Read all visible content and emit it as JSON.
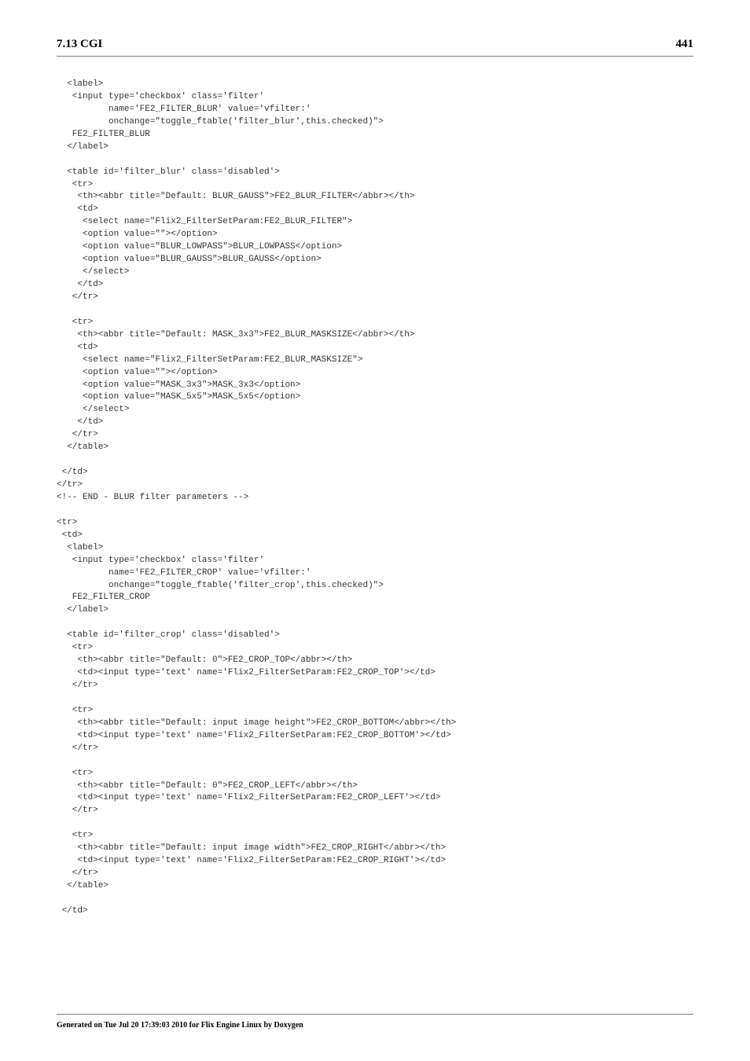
{
  "header": {
    "left": "7.13 CGI",
    "right": "441"
  },
  "code": "  <label>\n   <input type='checkbox' class='filter'\n          name='FE2_FILTER_BLUR' value='vfilter:'\n          onchange=\"toggle_ftable('filter_blur',this.checked)\">\n   FE2_FILTER_BLUR\n  </label>\n\n  <table id='filter_blur' class='disabled'>\n   <tr>\n    <th><abbr title=\"Default: BLUR_GAUSS\">FE2_BLUR_FILTER</abbr></th>\n    <td>\n     <select name=\"Flix2_FilterSetParam:FE2_BLUR_FILTER\">\n     <option value=\"\"></option>\n     <option value=\"BLUR_LOWPASS\">BLUR_LOWPASS</option>\n     <option value=\"BLUR_GAUSS\">BLUR_GAUSS</option>\n     </select>\n    </td>\n   </tr>\n\n   <tr>\n    <th><abbr title=\"Default: MASK_3x3\">FE2_BLUR_MASKSIZE</abbr></th>\n    <td>\n     <select name=\"Flix2_FilterSetParam:FE2_BLUR_MASKSIZE\">\n     <option value=\"\"></option>\n     <option value=\"MASK_3x3\">MASK_3x3</option>\n     <option value=\"MASK_5x5\">MASK_5x5</option>\n     </select>\n    </td>\n   </tr>\n  </table>\n\n </td>\n</tr>\n<!-- END - BLUR filter parameters -->\n\n<tr>\n <td>\n  <label>\n   <input type='checkbox' class='filter'\n          name='FE2_FILTER_CROP' value='vfilter:'\n          onchange=\"toggle_ftable('filter_crop',this.checked)\">\n   FE2_FILTER_CROP\n  </label>\n\n  <table id='filter_crop' class='disabled'>\n   <tr>\n    <th><abbr title=\"Default: 0\">FE2_CROP_TOP</abbr></th>\n    <td><input type='text' name='Flix2_FilterSetParam:FE2_CROP_TOP'></td>\n   </tr>\n\n   <tr>\n    <th><abbr title=\"Default: input image height\">FE2_CROP_BOTTOM</abbr></th>\n    <td><input type='text' name='Flix2_FilterSetParam:FE2_CROP_BOTTOM'></td>\n   </tr>\n\n   <tr>\n    <th><abbr title=\"Default: 0\">FE2_CROP_LEFT</abbr></th>\n    <td><input type='text' name='Flix2_FilterSetParam:FE2_CROP_LEFT'></td>\n   </tr>\n\n   <tr>\n    <th><abbr title=\"Default: input image width\">FE2_CROP_RIGHT</abbr></th>\n    <td><input type='text' name='Flix2_FilterSetParam:FE2_CROP_RIGHT'></td>\n   </tr>\n  </table>\n\n </td>",
  "footer": "Generated on Tue Jul 20 17:39:03 2010 for Flix Engine Linux by Doxygen"
}
